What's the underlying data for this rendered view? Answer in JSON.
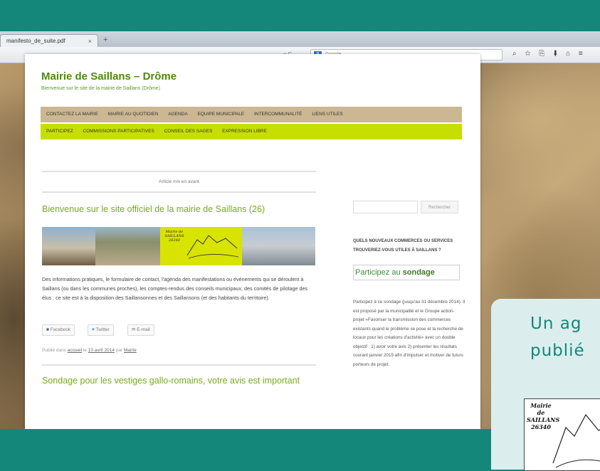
{
  "browser": {
    "tab_title": "manifesto_de_suite.pdf",
    "tab_close": "×",
    "new_tab": "+",
    "url_icons": "▿ C",
    "search_engine": "8",
    "search_placeholder": "Google",
    "toolbar_icons": "⌕ ☆ ⎘ ⬇ ⌂ ≡"
  },
  "site": {
    "title": "Mairie de Saillans – Drôme",
    "description": "Bienvenue sur le site de la mairie de Saillans (Drôme)",
    "menu_primary": [
      "CONTACTEZ LA MAIRIE",
      "MAIRIE AU QUOTIDIEN",
      "AGENDA",
      "EQUIPE MUNICIPALE",
      "INTERCOMMUNALITÉ",
      "LIENS UTILES"
    ],
    "menu_secondary": [
      "PARTICIPEZ",
      "COMMISSIONS PARTICIPATIVES",
      "CONSEIL DES SAGES",
      "EXPRESSION LIBRE"
    ]
  },
  "main": {
    "featured_label": "Article mis en avant",
    "post_title": "Bienvenue sur le site officiel de la mairie de Saillans (26)",
    "banner_label": "Mairie de SAILLANS 26340",
    "post_body": "Des informations pratiques, le formulaire de contact, l'agenda des manifestations ou événements qui se déroulent à Saillans (ou dans les communes proches), les comptes-rendus des conseils municipaux, des comités de pilotage des élus : ce site est à la disposition des Saillansonnes et des Saillansons (et des habitants du territoire).",
    "share": {
      "facebook": "Facebook",
      "twitter": "Twitter",
      "email": "E-mail"
    },
    "meta_prefix": "Publié dans",
    "meta_category": "accueil",
    "meta_le": "le",
    "meta_date": "10 avril 2014",
    "meta_par": "par",
    "meta_author": "Mairie",
    "post2_title": "Sondage pour les vestiges gallo-romains, votre avis est important"
  },
  "sidebar": {
    "search_button": "Rechercher",
    "heading": "QUELS NOUVEAUX COMMERCES OU SERVICES TROUVERIEZ-VOUS UTILES À SAILLANS ?",
    "sondage_prefix": "Participez au",
    "sondage_strong": "sondage",
    "text": "Participez à ce sondage (jusqu'au 31 décembre 2014). Il est proposé par la municipalité et le Groupe action-projet «Favoriser la transmission des commerces existants quand le problème se pose et la recherche de locaux pour les créations d'activité» avec un double objectif : 1) avoir votre avis 2) présenter les résultats courant janvier 2015 afin d'impulser et motiver de futurs porteurs de projet."
  },
  "overlay": {
    "line1": "Un ag",
    "line2": "publié",
    "logo_text": "Mairie de SAILLANS 26340"
  },
  "colors": {
    "teal": "#15877a",
    "green": "#77ac1e",
    "menu1": "#cbb791",
    "menu2": "#c7df00"
  }
}
